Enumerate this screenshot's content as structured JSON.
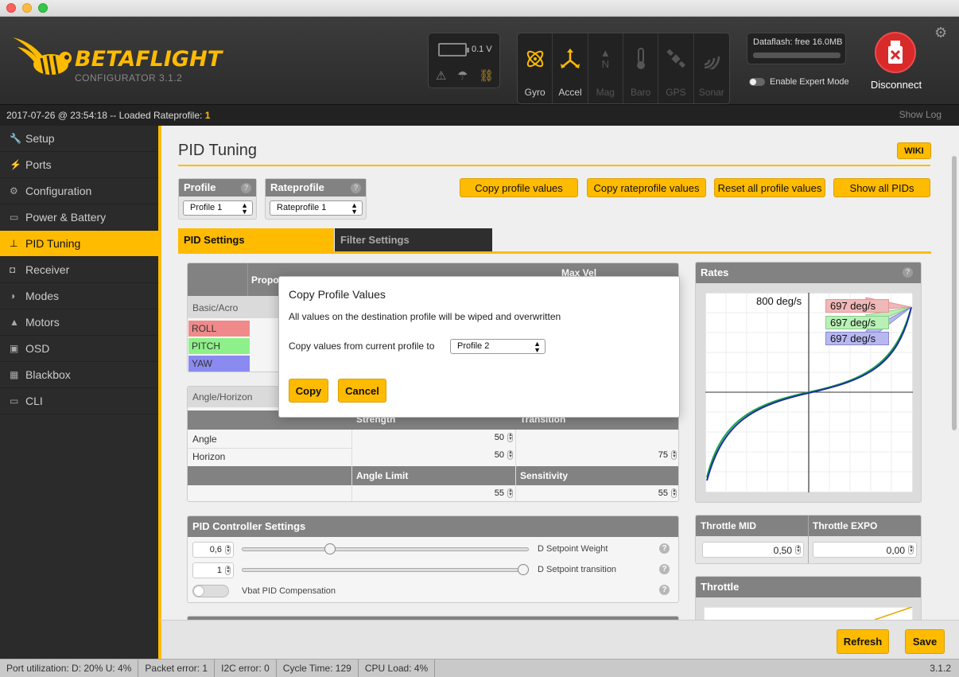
{
  "app": {
    "logo_title": "BETAFLIGHT",
    "logo_subtitle": "CONFIGURATOR  3.1.2",
    "battery_voltage": "0.1 V",
    "sensors": [
      {
        "label": "Gyro",
        "icon": "gyro-icon",
        "active": true
      },
      {
        "label": "Accel",
        "icon": "accel-icon",
        "active": true
      },
      {
        "label": "Mag",
        "icon": "mag-icon",
        "active": false
      },
      {
        "label": "Baro",
        "icon": "baro-icon",
        "active": false
      },
      {
        "label": "GPS",
        "icon": "gps-icon",
        "active": false
      },
      {
        "label": "Sonar",
        "icon": "sonar-icon",
        "active": false
      }
    ],
    "dataflash_label": "Dataflash: free 16.0MB",
    "expert_mode_label": "Enable Expert Mode",
    "disconnect_label": "Disconnect"
  },
  "log": {
    "text": "2017-07-26 @ 23:54:18 -- Loaded Rateprofile: ",
    "value": "1",
    "show_log": "Show Log"
  },
  "sidebar": {
    "items": [
      {
        "label": "Setup",
        "icon": "wrench-icon",
        "glyph": "🔧"
      },
      {
        "label": "Ports",
        "icon": "plug-icon",
        "glyph": "⚡"
      },
      {
        "label": "Configuration",
        "icon": "gear-icon",
        "glyph": "⚙"
      },
      {
        "label": "Power & Battery",
        "icon": "battery-icon",
        "glyph": "▭"
      },
      {
        "label": "PID Tuning",
        "icon": "sitemap-icon",
        "glyph": "⊥",
        "active": true
      },
      {
        "label": "Receiver",
        "icon": "receiver-icon",
        "glyph": "◘"
      },
      {
        "label": "Modes",
        "icon": "toggles-icon",
        "glyph": "◑"
      },
      {
        "label": "Motors",
        "icon": "motor-icon",
        "glyph": "▲"
      },
      {
        "label": "OSD",
        "icon": "osd-icon",
        "glyph": "▣"
      },
      {
        "label": "Blackbox",
        "icon": "blackbox-icon",
        "glyph": "▦"
      },
      {
        "label": "CLI",
        "icon": "terminal-icon",
        "glyph": "▭"
      }
    ]
  },
  "page": {
    "title": "PID Tuning",
    "wiki": "WIKI",
    "profile_label": "Profile",
    "profile_value": "Profile 1",
    "rateprofile_label": "Rateprofile",
    "rateprofile_value": "Rateprofile 1",
    "buttons": {
      "copy_profile": "Copy profile values",
      "copy_rateprofile": "Copy rateprofile values",
      "reset_all": "Reset all profile values",
      "show_all": "Show all PIDs"
    },
    "tabs": {
      "pid": "PID Settings",
      "filter": "Filter Settings"
    }
  },
  "pid_table": {
    "headers": [
      "Proportional",
      "Max Vel"
    ],
    "section": "Basic/Acro",
    "rows": [
      {
        "label": "ROLL",
        "color": "#f08a8a"
      },
      {
        "label": "PITCH",
        "color": "#8ef08a"
      },
      {
        "label": "YAW",
        "color": "#8a8af0"
      }
    ]
  },
  "angle": {
    "section": "Angle/Horizon",
    "col_strength": "Strength",
    "col_transition": "Transition",
    "rows": [
      {
        "label": "Angle",
        "strength": "50"
      },
      {
        "label": "Horizon",
        "strength": "50",
        "transition": "75"
      }
    ],
    "col_angle_limit": "Angle Limit",
    "col_sensitivity": "Sensitivity",
    "angle_limit": "55",
    "sensitivity": "55"
  },
  "controller": {
    "title": "PID Controller Settings",
    "setpoint_weight_value": "0,6",
    "setpoint_weight_label": "D Setpoint Weight",
    "setpoint_weight_fraction": 0.3,
    "setpoint_transition_value": "1",
    "setpoint_transition_label": "D Setpoint transition",
    "setpoint_transition_fraction": 1.0,
    "vbat_label": "Vbat PID Compensation"
  },
  "rates": {
    "title": "Rates",
    "max_label": "800 deg/s",
    "badges": [
      {
        "text": "697 deg/s",
        "color": "#f0b8b8"
      },
      {
        "text": "697 deg/s",
        "color": "#b8f0b8"
      },
      {
        "text": "697 deg/s",
        "color": "#b8b8f0"
      }
    ]
  },
  "throttle": {
    "mid_label": "Throttle MID",
    "mid_value": "0,50",
    "expo_label": "Throttle EXPO",
    "expo_value": "0,00",
    "chart_title": "Throttle"
  },
  "footer": {
    "refresh": "Refresh",
    "save": "Save"
  },
  "status": {
    "port": "Port utilization: D: 20% U: 4%",
    "packet": "Packet error: 1",
    "i2c": "I2C error: 0",
    "cycle": "Cycle Time: 129",
    "cpu": "CPU Load: 4%",
    "version": "3.1.2"
  },
  "dialog": {
    "title": "Copy Profile Values",
    "message": "All values on the destination profile will be wiped and overwritten",
    "label": "Copy values from current profile to",
    "selected": "Profile 2",
    "copy": "Copy",
    "cancel": "Cancel"
  }
}
